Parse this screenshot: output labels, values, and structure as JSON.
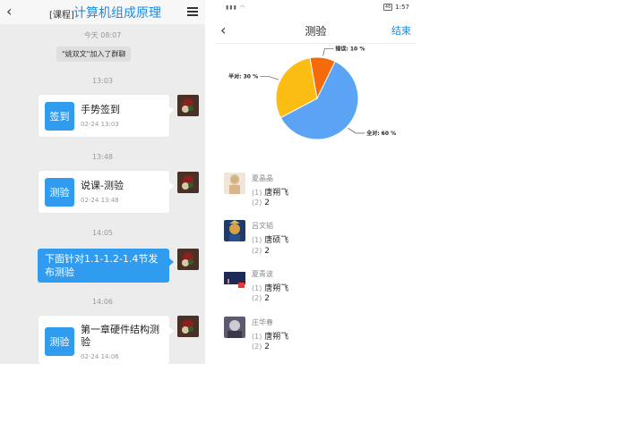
{
  "chat": {
    "header": {
      "back_icon": "chevron-left-icon",
      "course_tag": "[课程]",
      "course_title": "计算机组成原理",
      "menu_icon": "hamburger-menu-icon"
    },
    "items": [
      {
        "kind": "time",
        "text": "今天 08:07"
      },
      {
        "kind": "notice",
        "text": "\"姚双文\"加入了群聊"
      },
      {
        "kind": "time",
        "text": "13:03"
      },
      {
        "kind": "card",
        "icon_text": "签到",
        "title": "手势签到",
        "time": "02-24 13:03"
      },
      {
        "kind": "time",
        "text": "13:48"
      },
      {
        "kind": "card",
        "icon_text": "测验",
        "title": "说课-测验",
        "time": "02-24 13:48"
      },
      {
        "kind": "time",
        "text": "14:05"
      },
      {
        "kind": "bubble",
        "text": "下面针对1.1-1.2-1.4节发布测验"
      },
      {
        "kind": "time",
        "text": "14:06"
      },
      {
        "kind": "card",
        "icon_text": "测验",
        "title": "第一章硬件结构测验",
        "time": "02-24 14:06"
      }
    ]
  },
  "quiz": {
    "status_bar": {
      "time": "1:57",
      "battery": "46"
    },
    "nav": {
      "back_icon": "chevron-left-icon",
      "title": "测验",
      "end_label": "结束"
    },
    "responses": [
      {
        "name": "夏晶晶",
        "answers": [
          {
            "n": "(1)",
            "v": "唐朔飞"
          },
          {
            "n": "(2)",
            "v": "2"
          }
        ]
      },
      {
        "name": "吕文韬",
        "answers": [
          {
            "n": "(1)",
            "v": "唐硕飞"
          },
          {
            "n": "(2)",
            "v": "2"
          }
        ]
      },
      {
        "name": "夏青波",
        "answers": [
          {
            "n": "(1)",
            "v": "唐朔飞"
          },
          {
            "n": "(2)",
            "v": "2"
          }
        ]
      },
      {
        "name": "庄华春",
        "answers": [
          {
            "n": "(1)",
            "v": "唐朔飞"
          },
          {
            "n": "(2)",
            "v": "2"
          }
        ]
      }
    ]
  },
  "chart_data": {
    "type": "pie",
    "slices": [
      {
        "label": "全对: 60 %",
        "value": 60,
        "color": "#5ba3f5"
      },
      {
        "label": "半对: 30 %",
        "value": 30,
        "color": "#fbbc13"
      },
      {
        "label": "错误: 10 %",
        "value": 10,
        "color": "#f56a0a"
      }
    ]
  }
}
